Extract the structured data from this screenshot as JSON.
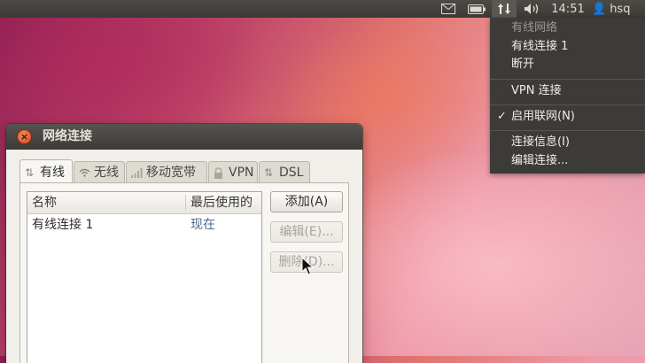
{
  "top_panel": {
    "clock": "14:51",
    "user": "hsq",
    "icons": [
      "mail-icon",
      "battery-icon",
      "network-updown-icon",
      "volume-icon",
      "user-icon"
    ]
  },
  "network_menu": {
    "section_header": "有线网络",
    "connection": "有线连接 1",
    "disconnect": "断开",
    "vpn": "VPN 连接",
    "enable_networking": "启用联网(N)",
    "connection_info": "连接信息(I)",
    "edit_connections": "编辑连接..."
  },
  "window": {
    "title": "网络连接",
    "tabs": [
      {
        "label": "有线",
        "icon": "updown-arrows-icon",
        "active": true
      },
      {
        "label": "无线",
        "icon": "wifi-icon",
        "active": false
      },
      {
        "label": "移动宽带",
        "icon": "signal-bars-icon",
        "active": false
      },
      {
        "label": "VPN",
        "icon": "lock-icon",
        "active": false
      },
      {
        "label": "DSL",
        "icon": "updown-arrows-icon",
        "active": false
      }
    ],
    "list": {
      "columns": [
        "名称",
        "最后使用的"
      ],
      "rows": [
        {
          "name": "有线连接 1",
          "last_used": "现在"
        }
      ]
    },
    "buttons": {
      "add": "添加(A)",
      "edit": "编辑(E)...",
      "delete": "删除(D)..."
    }
  },
  "colors": {
    "panel": "#3c3b37",
    "close_button": "#e05a2a",
    "last_used_text": "#4a6b8a"
  }
}
